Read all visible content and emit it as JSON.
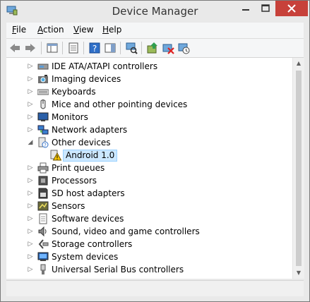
{
  "window": {
    "title": "Device Manager"
  },
  "menubar": [
    {
      "accel": "F",
      "rest": "ile"
    },
    {
      "accel": "A",
      "rest": "ction"
    },
    {
      "accel": "V",
      "rest": "iew"
    },
    {
      "accel": "H",
      "rest": "elp"
    }
  ],
  "toolbar": [
    "back-icon",
    "forward-icon",
    "show-hide-tree-icon",
    "properties-icon",
    "help-icon",
    "action-pane-icon",
    "scan-hardware-icon",
    "update-driver-icon",
    "uninstall-device-icon",
    "enable-device-icon"
  ],
  "tree": {
    "items": [
      {
        "label": "IDE ATA/ATAPI controllers",
        "icon": "ide-controller-icon",
        "expanded": false
      },
      {
        "label": "Imaging devices",
        "icon": "camera-icon",
        "expanded": false
      },
      {
        "label": "Keyboards",
        "icon": "keyboard-icon",
        "expanded": false
      },
      {
        "label": "Mice and other pointing devices",
        "icon": "mouse-icon",
        "expanded": false
      },
      {
        "label": "Monitors",
        "icon": "monitor-icon",
        "expanded": false
      },
      {
        "label": "Network adapters",
        "icon": "network-icon",
        "expanded": false
      },
      {
        "label": "Other devices",
        "icon": "unknown-device-icon",
        "expanded": true
      },
      {
        "label": "Android 1.0",
        "icon": "warning-device-icon",
        "child": true,
        "selected": true
      },
      {
        "label": "Print queues",
        "icon": "printer-icon",
        "expanded": false
      },
      {
        "label": "Processors",
        "icon": "processor-icon",
        "expanded": false
      },
      {
        "label": "SD host adapters",
        "icon": "sd-card-icon",
        "expanded": false
      },
      {
        "label": "Sensors",
        "icon": "sensor-icon",
        "expanded": false
      },
      {
        "label": "Software devices",
        "icon": "software-device-icon",
        "expanded": false
      },
      {
        "label": "Sound, video and game controllers",
        "icon": "speaker-icon",
        "expanded": false
      },
      {
        "label": "Storage controllers",
        "icon": "storage-icon",
        "expanded": false
      },
      {
        "label": "System devices",
        "icon": "system-icon",
        "expanded": false
      },
      {
        "label": "Universal Serial Bus controllers",
        "icon": "usb-icon",
        "expanded": false
      }
    ]
  },
  "colors": {
    "close_button": "#c7413a",
    "selection": "#cce8ff",
    "selection_border": "#99d1ff"
  }
}
